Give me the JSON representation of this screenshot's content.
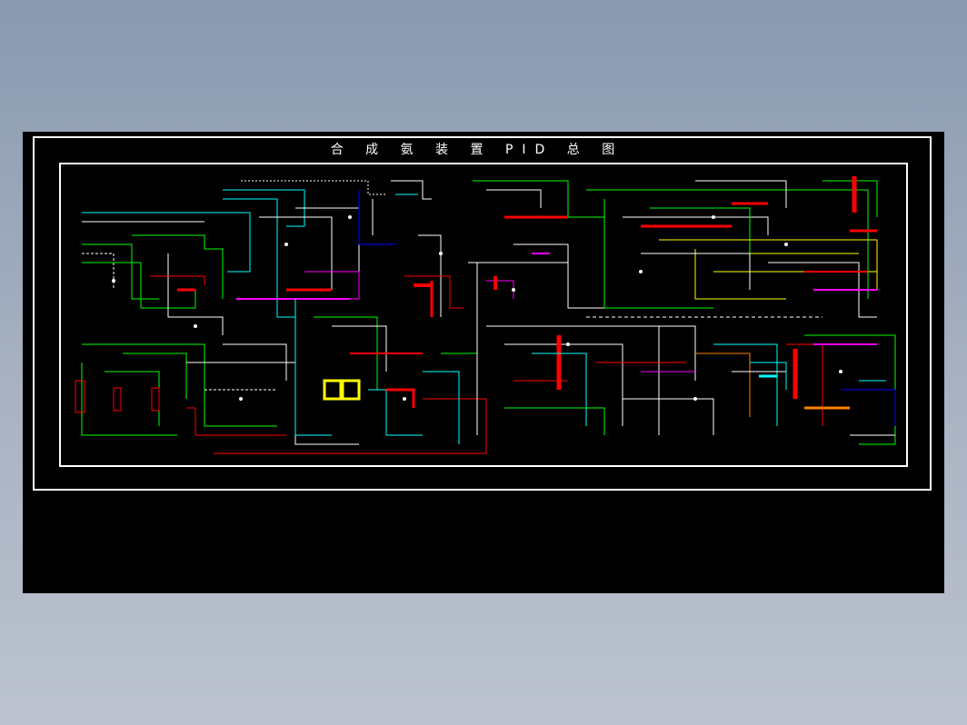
{
  "drawing": {
    "title": "合 成 氨 装 置 PID 总 图"
  },
  "colors": {
    "background": "#000000",
    "frame": "#ffffff",
    "lines": [
      "#00ff00",
      "#00ffff",
      "#ffffff",
      "#ffff00",
      "#ff0000",
      "#ff00ff",
      "#0000ff",
      "#ff8000"
    ]
  }
}
